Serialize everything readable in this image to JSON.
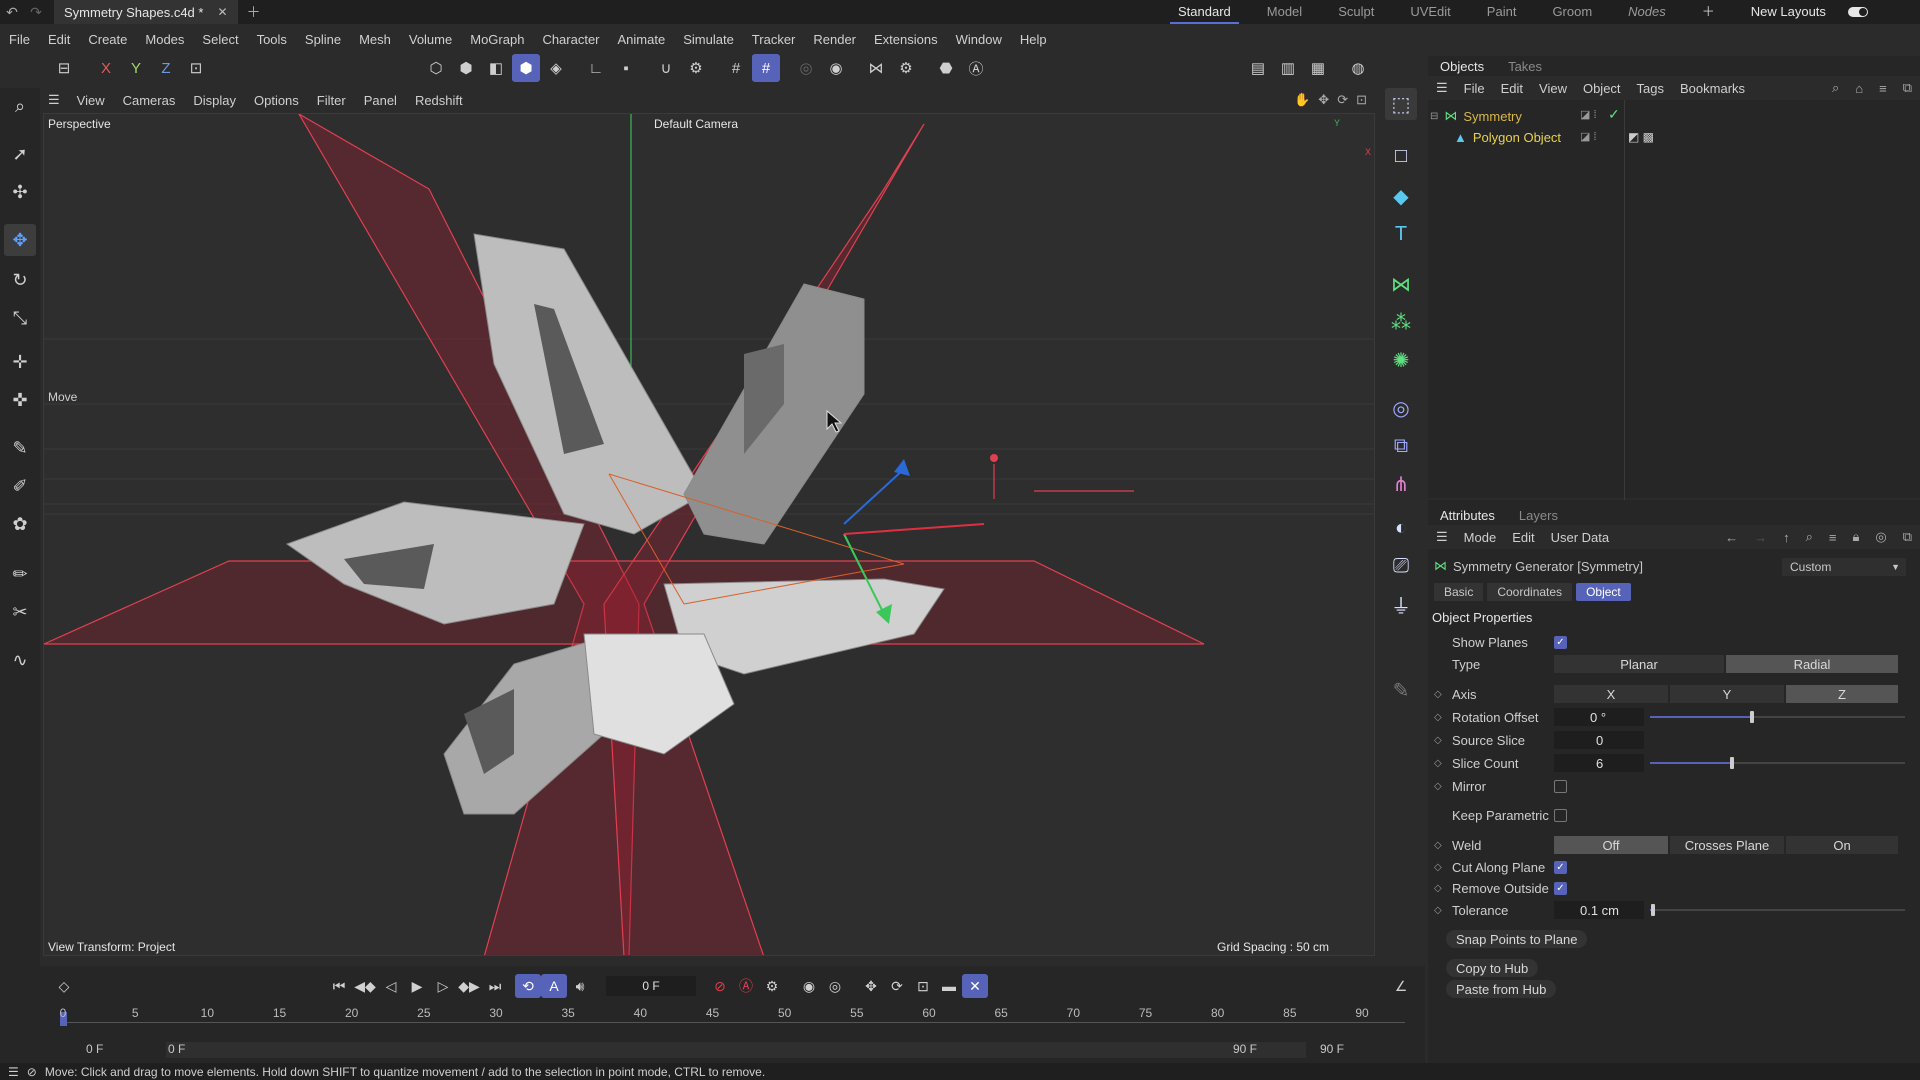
{
  "window": {
    "file_tab": "Symmetry Shapes.c4d *",
    "layouts": [
      "Standard",
      "Model",
      "Sculpt",
      "UVEdit",
      "Paint",
      "Groom",
      "Nodes"
    ],
    "active_layout": "Standard",
    "new_layouts": "New Layouts"
  },
  "menubar": [
    "File",
    "Edit",
    "Create",
    "Modes",
    "Select",
    "Tools",
    "Spline",
    "Mesh",
    "Volume",
    "MoGraph",
    "Character",
    "Animate",
    "Simulate",
    "Tracker",
    "Render",
    "Extensions",
    "Window",
    "Help"
  ],
  "viewport": {
    "menu": [
      "View",
      "Cameras",
      "Display",
      "Options",
      "Filter",
      "Panel",
      "Redshift"
    ],
    "name": "Perspective",
    "camera": "Default Camera",
    "tool": "Move",
    "transform": "View Transform: Project",
    "grid": "Grid Spacing : 50 cm",
    "axis_y": "Y",
    "axis_x": "X"
  },
  "objects_panel": {
    "tabs": [
      "Objects",
      "Takes"
    ],
    "menu": [
      "File",
      "Edit",
      "View",
      "Object",
      "Tags",
      "Bookmarks"
    ],
    "items": [
      {
        "name": "Symmetry",
        "color": "#d8b84a"
      },
      {
        "name": "Polygon Object",
        "color": "#e8d24a"
      }
    ]
  },
  "attributes_panel": {
    "tabs": [
      "Attributes",
      "Layers"
    ],
    "menu": [
      "Mode",
      "Edit",
      "User Data"
    ],
    "object_title": "Symmetry Generator [Symmetry]",
    "preset": "Custom",
    "subtabs": [
      "Basic",
      "Coordinates",
      "Object"
    ],
    "active_subtab": "Object",
    "section": "Object Properties",
    "show_planes_label": "Show Planes",
    "type_label": "Type",
    "type_options": [
      "Planar",
      "Radial"
    ],
    "axis_label": "Axis",
    "axis_options": [
      "X",
      "Y",
      "Z"
    ],
    "rotation_offset_label": "Rotation Offset",
    "rotation_offset": "0 °",
    "rotation_offset_level": 0.4,
    "source_slice_label": "Source Slice",
    "source_slice": "0",
    "slice_count_label": "Slice Count",
    "slice_count": "6",
    "slice_count_level": 0.32,
    "mirror_label": "Mirror",
    "keep_parametric_label": "Keep Parametric",
    "weld_label": "Weld",
    "weld_options": [
      "Off",
      "Crosses Plane",
      "On"
    ],
    "cut_along_plane_label": "Cut Along Plane",
    "remove_outside_label": "Remove Outside",
    "tolerance_label": "Tolerance",
    "tolerance": "0.1 cm",
    "tolerance_level": 0.01,
    "snap_button": "Snap Points to Plane",
    "copy_hub": "Copy to Hub",
    "paste_hub": "Paste from Hub"
  },
  "timeline": {
    "current_frame": "0 F",
    "ticks": [
      "0",
      "5",
      "10",
      "15",
      "20",
      "25",
      "30",
      "35",
      "40",
      "45",
      "50",
      "55",
      "60",
      "65",
      "70",
      "75",
      "80",
      "85",
      "90"
    ],
    "start": "0 F",
    "start2": "0 F",
    "end": "90 F",
    "end2": "90 F"
  },
  "status": "Move: Click and drag to move elements. Hold down SHIFT to quantize movement / add to the selection in point mode, CTRL to remove.",
  "colors": {
    "accent": "#5663b8",
    "plane": "#c0263a"
  }
}
